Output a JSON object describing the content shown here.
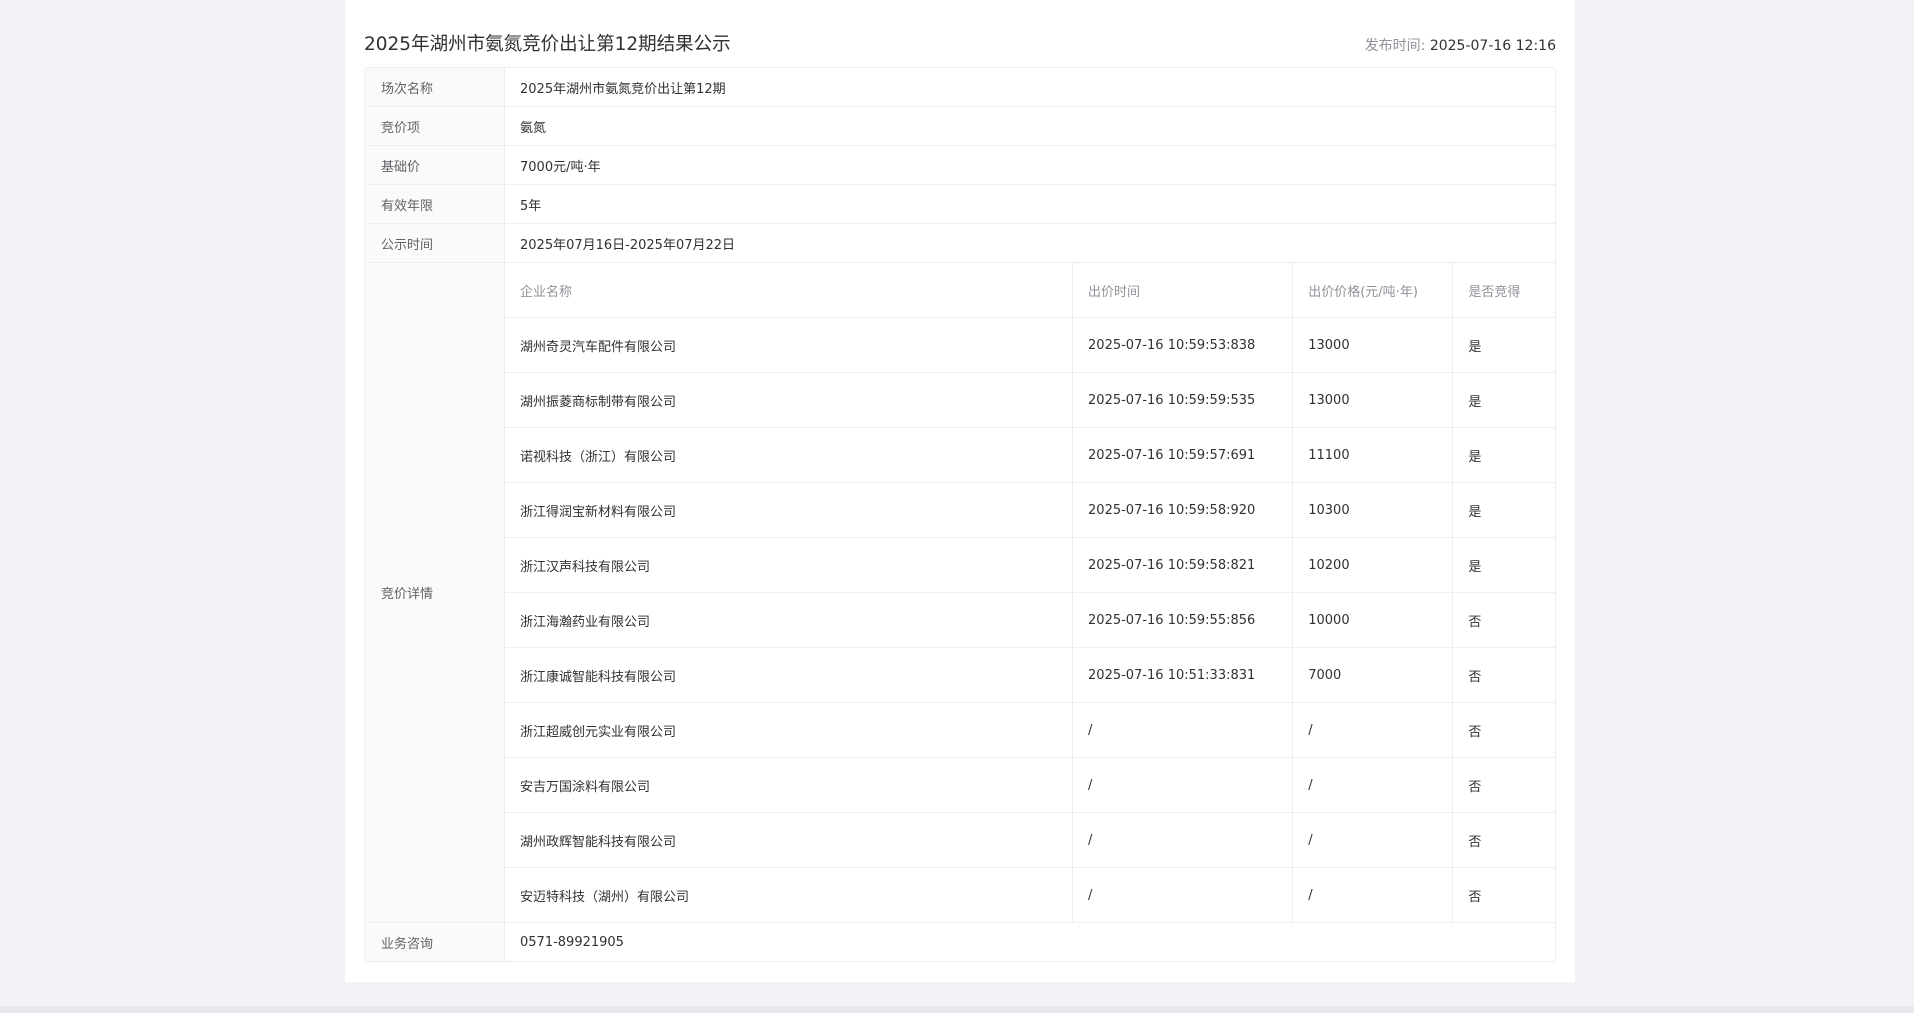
{
  "page": {
    "title": "2025年湖州市氨氮竞价出让第12期结果公示",
    "publish_label": "发布时间: ",
    "publish_time": "2025-07-16 12:16"
  },
  "info": {
    "session_name_label": "场次名称",
    "session_name": "2025年湖州市氨氮竞价出让第12期",
    "item_label": "竞价项",
    "item": "氨氮",
    "base_price_label": "基础价",
    "base_price": "7000元/吨·年",
    "validity_label": "有效年限",
    "validity": "5年",
    "notice_period_label": "公示时间",
    "notice_period": "2025年07月16日-2025年07月22日",
    "details_label": "竞价详情",
    "consult_label": "业务咨询",
    "consult": "0571-89921905"
  },
  "bids": {
    "headers": [
      "企业名称",
      "出价时间",
      "出价价格(元/吨·年)",
      "是否竞得"
    ],
    "rows": [
      [
        "湖州奇灵汽车配件有限公司",
        "2025-07-16 10:59:53:838",
        "13000",
        "是"
      ],
      [
        "湖州振菱商标制带有限公司",
        "2025-07-16 10:59:59:535",
        "13000",
        "是"
      ],
      [
        "诺视科技（浙江）有限公司",
        "2025-07-16 10:59:57:691",
        "11100",
        "是"
      ],
      [
        "浙江得润宝新材料有限公司",
        "2025-07-16 10:59:58:920",
        "10300",
        "是"
      ],
      [
        "浙江汉声科技有限公司",
        "2025-07-16 10:59:58:821",
        "10200",
        "是"
      ],
      [
        "浙江海瀚药业有限公司",
        "2025-07-16 10:59:55:856",
        "10000",
        "否"
      ],
      [
        "浙江康诚智能科技有限公司",
        "2025-07-16 10:51:33:831",
        "7000",
        "否"
      ],
      [
        "浙江超威创元实业有限公司",
        "/",
        "/",
        "否"
      ],
      [
        "安吉万国涂料有限公司",
        "/",
        "/",
        "否"
      ],
      [
        "湖州政辉智能科技有限公司",
        "/",
        "/",
        "否"
      ],
      [
        "安迈特科技（湖州）有限公司",
        "/",
        "/",
        "否"
      ]
    ]
  }
}
